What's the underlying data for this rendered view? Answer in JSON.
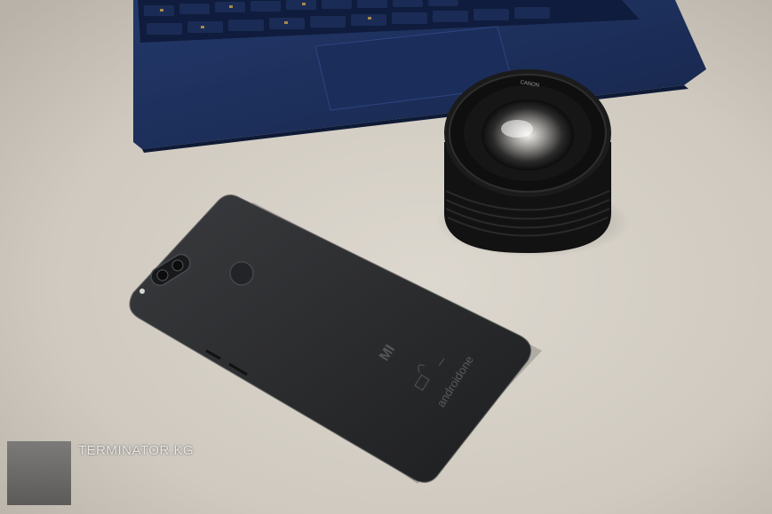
{
  "photo": {
    "subject": "black smartphone next to a camera lens and laptop",
    "watermark_text": "TERMINATOR.KG",
    "phone_logo": "MI",
    "phone_branding": "androidone",
    "lens_text": "CANON",
    "colors": {
      "background": "#cfc9bf",
      "laptop": "#1d2f59",
      "phone": "#2a2b2d",
      "lens": "#141414"
    }
  }
}
